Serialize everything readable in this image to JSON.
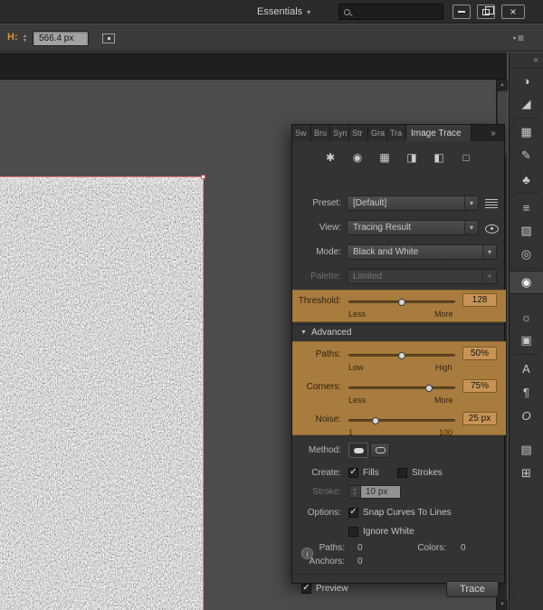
{
  "glyphs": {
    "caret_down": "▾",
    "tri_up": "▲",
    "tri_down": "▼",
    "check": "✓",
    "overflow": "»",
    "collapse": "«",
    "menu_lines": "≡",
    "advanced_caret": "▼",
    "close": "×"
  },
  "titlebar": {
    "workspace": "Essentials"
  },
  "controlbar": {
    "h_label": "H:",
    "h_value": "566.4 px"
  },
  "panel": {
    "tabs": [
      "Sw",
      "Bru",
      "Syn",
      "Str",
      "Gra",
      "Tra"
    ],
    "active_tab": "Image Trace",
    "preset_icons": [
      {
        "name": "auto-color",
        "glyph": "✱"
      },
      {
        "name": "high-color",
        "glyph": "◉"
      },
      {
        "name": "low-color",
        "glyph": "▦"
      },
      {
        "name": "grayscale",
        "glyph": "◨"
      },
      {
        "name": "black-and-white",
        "glyph": "◧"
      },
      {
        "name": "outline",
        "glyph": "□"
      }
    ],
    "preset": {
      "label": "Preset:",
      "value": "[Default]"
    },
    "view": {
      "label": "View:",
      "value": "Tracing Result"
    },
    "mode": {
      "label": "Mode:",
      "value": "Black and White"
    },
    "palette": {
      "label": "Palette:",
      "value": "Limited"
    },
    "sliders": {
      "threshold": {
        "label": "Threshold:",
        "value": "128",
        "min_label": "Less",
        "max_label": "More",
        "percent": 50
      },
      "paths": {
        "label": "Paths:",
        "value": "50%",
        "min_label": "Low",
        "max_label": "High",
        "percent": 50
      },
      "corners": {
        "label": "Corners:",
        "value": "75%",
        "min_label": "Less",
        "max_label": "More",
        "percent": 75
      },
      "noise": {
        "label": "Noise:",
        "value": "25 px",
        "min_label": "1",
        "max_label": "100",
        "percent": 25
      }
    },
    "advanced_label": "Advanced",
    "method_label": "Method:",
    "create": {
      "label": "Create:",
      "fills_label": "Fills",
      "fills_mark": "✓",
      "strokes_label": "Strokes",
      "strokes_mark": ""
    },
    "stroke": {
      "label": "Stroke:",
      "value": "10 px"
    },
    "options": {
      "label": "Options:",
      "snap_label": "Snap Curves To Lines",
      "snap_mark": "✓",
      "ignore_label": "Ignore White",
      "ignore_mark": ""
    },
    "info": {
      "icon_letter": "i",
      "paths_label": "Paths:",
      "paths_value": "0",
      "colors_label": "Colors:",
      "colors_value": "0",
      "anchors_label": "Anchors:",
      "anchors_value": "0"
    },
    "footer": {
      "preview_label": "Preview",
      "preview_mark": "✓",
      "trace_label": "Trace"
    }
  },
  "dock": {
    "items": [
      {
        "name": "color",
        "glyph": "◑"
      },
      {
        "name": "color-guide",
        "glyph": "◢"
      },
      {
        "name": "swatches",
        "glyph": "▦"
      },
      {
        "name": "brushes",
        "glyph": "✎"
      },
      {
        "name": "symbols",
        "glyph": "♣"
      },
      {
        "name": "stroke",
        "glyph": "≡"
      },
      {
        "name": "gradient",
        "glyph": "▨"
      },
      {
        "name": "transparency",
        "glyph": "◎"
      },
      {
        "name": "image-trace",
        "glyph": "◉"
      },
      {
        "name": "appearance",
        "glyph": "☼"
      },
      {
        "name": "graphic-styles",
        "glyph": "▣"
      },
      {
        "name": "character",
        "glyph": "A"
      },
      {
        "name": "paragraph",
        "glyph": "¶"
      },
      {
        "name": "opentype",
        "glyph": "O"
      },
      {
        "name": "layers",
        "glyph": "▤"
      },
      {
        "name": "artboards",
        "glyph": "⊞"
      }
    ]
  }
}
